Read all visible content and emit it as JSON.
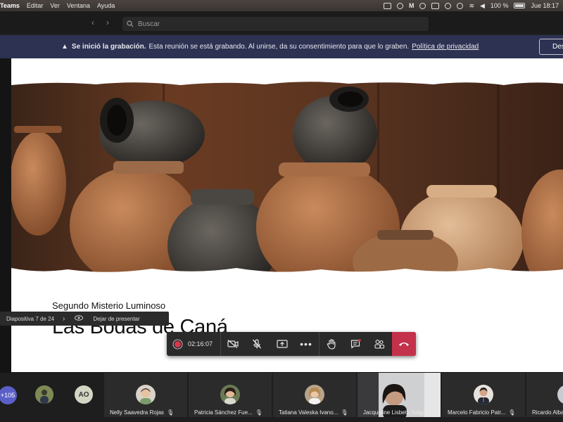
{
  "menubar": {
    "app": "Teams",
    "menus": [
      "Editar",
      "Ver",
      "Ventana",
      "Ayuda"
    ],
    "battery": "100 %",
    "clock": "Jue 18:17"
  },
  "search": {
    "placeholder": "Buscar"
  },
  "banner": {
    "title": "Se inició la grabación.",
    "message": "Esta reunión se está grabando. Al unirse, da su consentimiento para que lo graben.",
    "link": "Política de privacidad",
    "button": "Des"
  },
  "slide": {
    "subtitle": "Segundo Misterio Luminoso",
    "title": "Las Bodas de Caná"
  },
  "presenter_toolbar": {
    "slide_counter": "Diapositiva 7 de 24",
    "stop_label": "Dejar de presentar"
  },
  "controls": {
    "timer": "02:16:07",
    "accent": "#c4314b"
  },
  "participants": {
    "overflow": "+105",
    "initials": "AO",
    "tiles": [
      {
        "name": "Nelly Saavedra Rojas"
      },
      {
        "name": "Patricia Sánchez Fue..."
      },
      {
        "name": "Tatiana Valeska Ivano..."
      },
      {
        "name": "Jacqueline Lisbeth Salgad..."
      },
      {
        "name": "Marcelo Fabricio Patr..."
      },
      {
        "name": "Ricardo Alba"
      }
    ]
  }
}
